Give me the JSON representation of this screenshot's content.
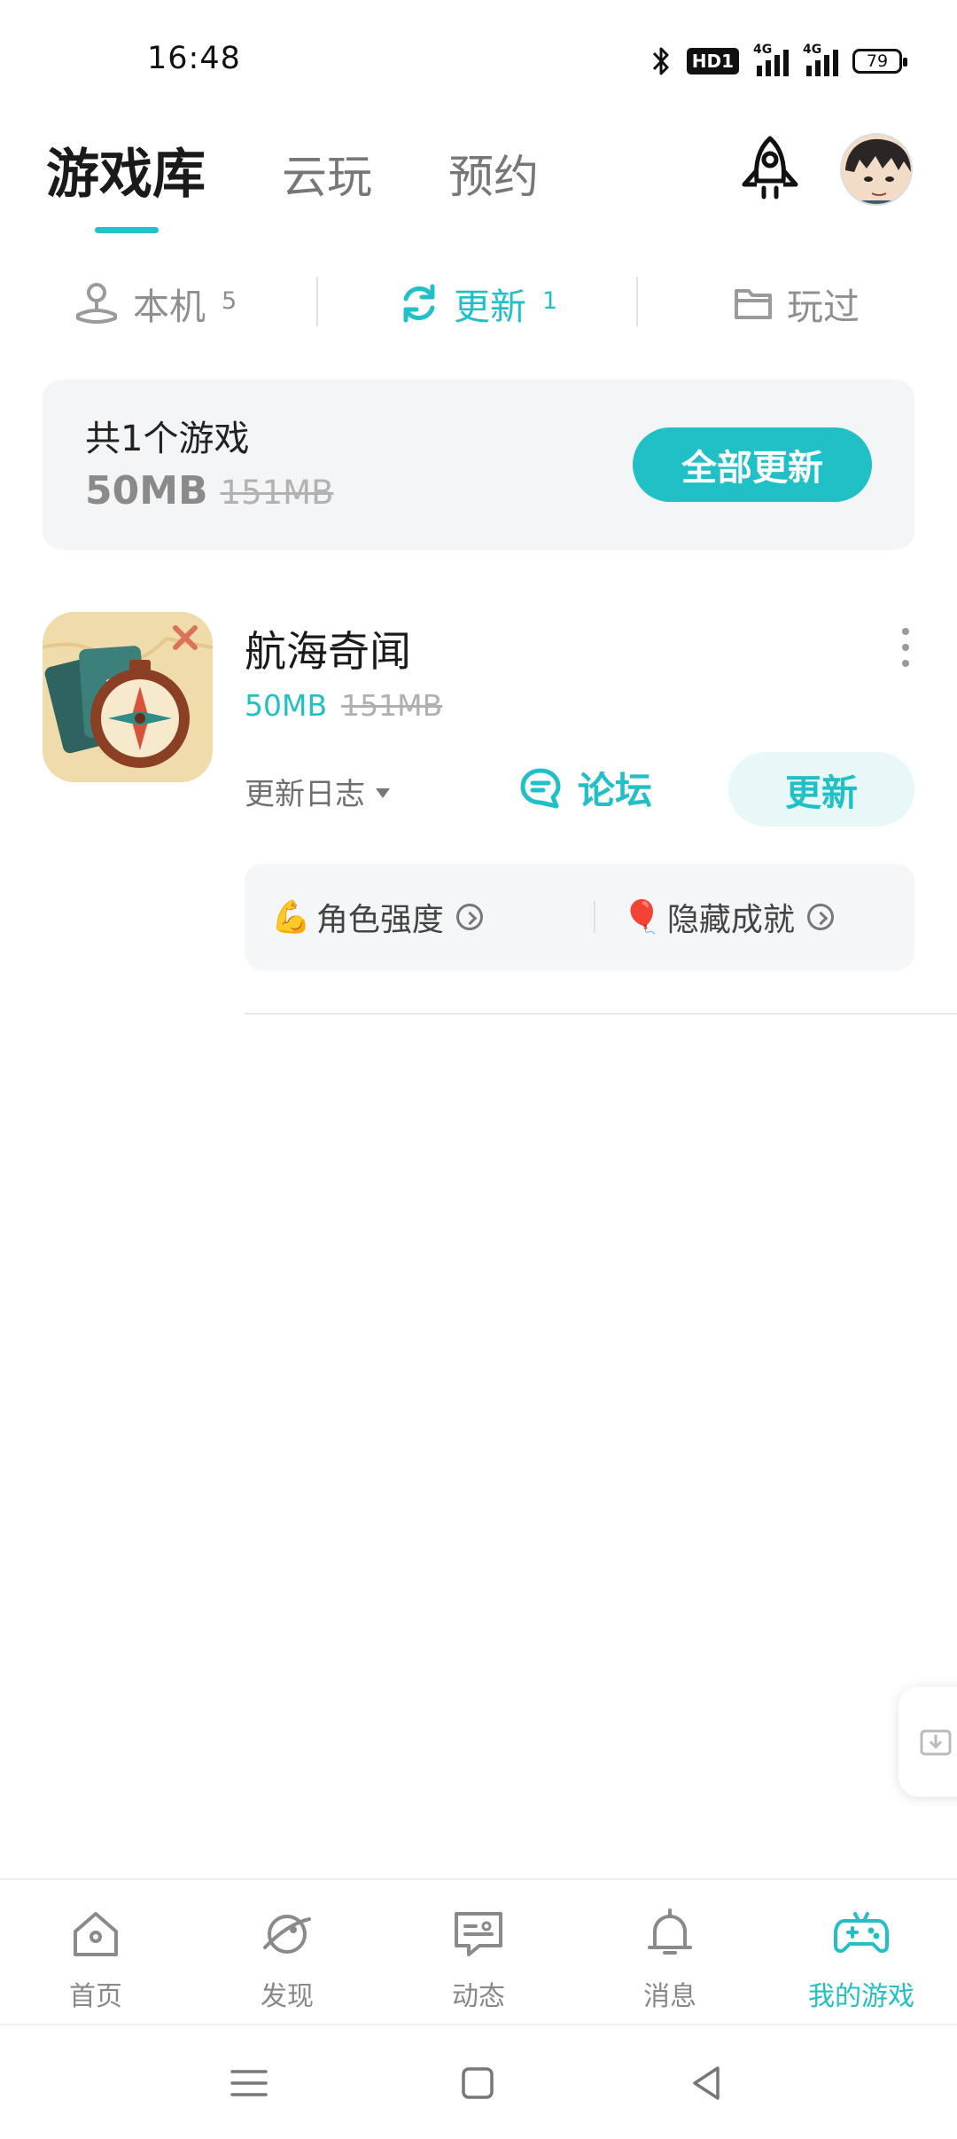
{
  "status_bar": {
    "time": "16:48",
    "hd_label": "HD1",
    "signal_1_label": "4G",
    "signal_2_label": "4G",
    "battery": "79",
    "icons": [
      "bluetooth-icon",
      "hd-icon",
      "signal-icon",
      "signal-icon",
      "battery-icon"
    ]
  },
  "header": {
    "tabs": [
      {
        "label": "游戏库",
        "active": true
      },
      {
        "label": "云玩",
        "active": false
      },
      {
        "label": "预约",
        "active": false
      }
    ],
    "icons": [
      "rocket-icon",
      "avatar"
    ]
  },
  "subtabs": [
    {
      "label": "本机",
      "count": "5",
      "icon": "joystick-icon",
      "active": false
    },
    {
      "label": "更新",
      "count": "1",
      "icon": "refresh-icon",
      "active": true
    },
    {
      "label": "玩过",
      "count": "",
      "icon": "folder-icon",
      "active": false
    }
  ],
  "summary": {
    "title": "共1个游戏",
    "size": "50MB",
    "old_size": "151MB",
    "update_all_label": "全部更新"
  },
  "game": {
    "name": "航海奇闻",
    "size": "50MB",
    "old_size": "151MB",
    "changelog_label": "更新日志",
    "forum_label": "论坛",
    "update_label": "更新",
    "tags": [
      {
        "emoji": "💪",
        "label": "角色强度"
      },
      {
        "emoji": "🎈",
        "label": "隐藏成就"
      }
    ]
  },
  "bottom_nav": [
    {
      "label": "首页",
      "icon": "home-icon",
      "active": false
    },
    {
      "label": "发现",
      "icon": "discover-icon",
      "active": false
    },
    {
      "label": "动态",
      "icon": "feed-icon",
      "active": false
    },
    {
      "label": "消息",
      "icon": "bell-icon",
      "active": false
    },
    {
      "label": "我的游戏",
      "icon": "gamepad-icon",
      "active": true
    }
  ],
  "colors": {
    "accent": "#21bfc6",
    "card_bg": "#f4f5f7",
    "text_primary": "#1a1a1a",
    "text_muted": "#8f8f8f"
  }
}
